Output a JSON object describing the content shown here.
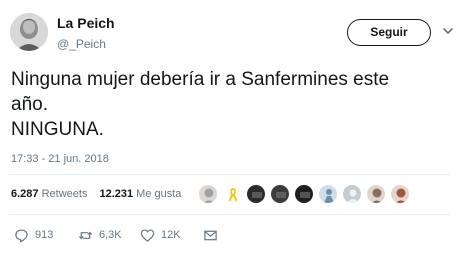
{
  "author": {
    "name": "La Peich",
    "handle": "@_Peich"
  },
  "follow_button_label": "Seguir",
  "tweet": {
    "text": "Ninguna mujer debería ir a Sanfermines este\naño.\nNINGUNA.",
    "timestamp": "17:33 - 21 jun. 2018"
  },
  "stats": {
    "retweets_count": "6.287",
    "retweets_label": "Retweets",
    "likes_count": "12.231",
    "likes_label": "Me gusta"
  },
  "likers": [
    {
      "icon": "avatar-face",
      "color": "#9aa3a8"
    },
    {
      "icon": "yellow-ribbon",
      "color": "#f5c518"
    },
    {
      "icon": "avatar-dark",
      "color": "#2b2b2b"
    },
    {
      "icon": "avatar-dark",
      "color": "#3b3b3b"
    },
    {
      "icon": "avatar-dark",
      "color": "#1f1f1f"
    },
    {
      "icon": "avatar-figure",
      "color": "#6d8fa8"
    },
    {
      "icon": "avatar-default",
      "color": "#c4ccd1"
    },
    {
      "icon": "avatar-face",
      "color": "#8a6d5a"
    },
    {
      "icon": "avatar-face",
      "color": "#a0563d"
    }
  ],
  "actions": {
    "reply_count": "913",
    "retweet_count": "6,3K",
    "like_count": "12K"
  },
  "colors": {
    "text": "#14171a",
    "muted": "#657786",
    "divider": "#e6ecf0"
  }
}
